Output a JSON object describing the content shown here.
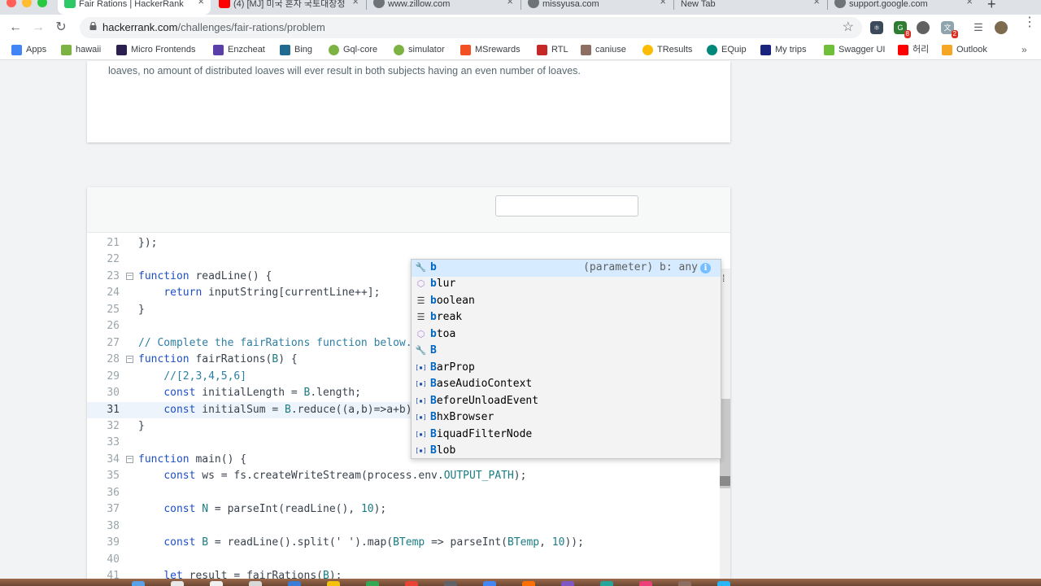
{
  "browser": {
    "tabs": [
      {
        "title": "Fair Rations | HackerRank",
        "icon": "hackerrank-icon",
        "active": true
      },
      {
        "title": "(4) [MJ] 미국 혼자 국토대장정",
        "icon": "youtube-icon",
        "active": false
      },
      {
        "title": "www.zillow.com",
        "icon": "globe-icon",
        "active": false
      },
      {
        "title": "missyusa.com",
        "icon": "globe-icon",
        "active": false
      },
      {
        "title": "New Tab",
        "icon": "none",
        "active": false
      },
      {
        "title": "support.google.com",
        "icon": "globe-icon",
        "active": false
      }
    ],
    "new_tab": "+",
    "close_glyph": "×",
    "url_host": "hackerrank.com",
    "url_path": "/challenges/fair-rations/problem",
    "extension_badges": [
      "8",
      "2"
    ],
    "bookmarks": [
      {
        "label": "Apps",
        "icon": "apps-grid-icon",
        "color": "#4285f4"
      },
      {
        "label": "hawaii",
        "icon": "hawaii-icon",
        "color": "#7cb342"
      },
      {
        "label": "Micro Frontends",
        "icon": "f-logo-icon",
        "color": "#2b1f4f"
      },
      {
        "label": "Enzcheat",
        "icon": "enzyme-icon",
        "color": "#5b3fa8"
      },
      {
        "label": "Bing",
        "icon": "bing-icon",
        "color": "#1e6b8f"
      },
      {
        "label": "Gql-core",
        "icon": "green-circle-icon",
        "color": "#7cb342"
      },
      {
        "label": "simulator",
        "icon": "green-circle-icon",
        "color": "#7cb342"
      },
      {
        "label": "MSrewards",
        "icon": "microsoft-icon",
        "color": "#f25022"
      },
      {
        "label": "RTL",
        "icon": "octopus-icon",
        "color": "#c62828"
      },
      {
        "label": "caniuse",
        "icon": "caniuse-icon",
        "color": "#8d6e63"
      },
      {
        "label": "TResults",
        "icon": "loader-icon",
        "color": "#fbbc05"
      },
      {
        "label": "EQuip",
        "icon": "equip-icon",
        "color": "#00897b"
      },
      {
        "label": "My trips",
        "icon": "v-logo-icon",
        "color": "#1a237e"
      },
      {
        "label": "Swagger UI",
        "icon": "swagger-icon",
        "color": "#6fbf3a"
      },
      {
        "label": "허리",
        "icon": "youtube-icon",
        "color": "#ff0000"
      },
      {
        "label": "Outlook",
        "icon": "outlook-icon",
        "color": "#f5a623"
      }
    ],
    "bookmarks_more": "»"
  },
  "problem": {
    "text": "loaves, no amount of distributed loaves will ever result in both subjects having an even number of loaves."
  },
  "editor": {
    "lines": [
      {
        "n": "21",
        "fold": false,
        "html": "});"
      },
      {
        "n": "22",
        "fold": false,
        "html": ""
      },
      {
        "n": "23",
        "fold": true,
        "html": "<span class=\"kw\">function</span> readLine() {"
      },
      {
        "n": "24",
        "fold": false,
        "html": "    <span class=\"kw\">return</span> inputString[currentLine++];"
      },
      {
        "n": "25",
        "fold": false,
        "html": "}"
      },
      {
        "n": "26",
        "fold": false,
        "html": ""
      },
      {
        "n": "27",
        "fold": false,
        "html": "<span class=\"cm\">// Complete the fairRations function below.</span>"
      },
      {
        "n": "28",
        "fold": true,
        "html": "<span class=\"kw\">function</span> fairRations(<span class=\"cn\">B</span>) {"
      },
      {
        "n": "29",
        "fold": false,
        "html": "    <span class=\"cm\">//[2,3,4,5,6]</span>"
      },
      {
        "n": "30",
        "fold": false,
        "html": "    <span class=\"kw\">const</span> initialLength = <span class=\"cn\">B</span>.length;"
      },
      {
        "n": "31",
        "fold": false,
        "current": true,
        "html": "    <span class=\"kw\">const</span> initialSum = <span class=\"cn\">B</span>.reduce((a,b)=>a+b)"
      },
      {
        "n": "32",
        "fold": false,
        "html": "}"
      },
      {
        "n": "33",
        "fold": false,
        "html": ""
      },
      {
        "n": "34",
        "fold": true,
        "html": "<span class=\"kw\">function</span> main() {"
      },
      {
        "n": "35",
        "fold": false,
        "html": "    <span class=\"kw\">const</span> ws = fs.createWriteStream(process.env.<span class=\"cn\">OUTPUT_PATH</span>);"
      },
      {
        "n": "36",
        "fold": false,
        "html": ""
      },
      {
        "n": "37",
        "fold": false,
        "html": "    <span class=\"kw\">const</span> <span class=\"cn\">N</span> = parseInt(readLine(), <span class=\"nm\">10</span>);"
      },
      {
        "n": "38",
        "fold": false,
        "html": ""
      },
      {
        "n": "39",
        "fold": false,
        "html": "    <span class=\"kw\">const</span> <span class=\"cn\">B</span> = readLine().split(<span class=\"st\">' '</span>).map(<span class=\"cn\">BTemp</span> => parseInt(<span class=\"cn\">BTemp</span>, <span class=\"nm\">10</span>));"
      },
      {
        "n": "40",
        "fold": false,
        "html": ""
      },
      {
        "n": "41",
        "fold": false,
        "html": "    <span class=\"kw\">let</span> result = fairRations(<span class=\"cn\">B</span>);"
      }
    ],
    "autocomplete": {
      "detail": "(parameter) b: any",
      "info": "i",
      "items": [
        {
          "match": "b",
          "rest": "",
          "icon": "wrench-icon",
          "glyph": "🔧",
          "color": "#424242",
          "selected": true
        },
        {
          "match": "b",
          "rest": "lur",
          "icon": "cube-icon",
          "glyph": "⬡",
          "color": "#b180d7",
          "selected": false
        },
        {
          "match": "b",
          "rest": "oolean",
          "icon": "keyword-icon",
          "glyph": "☰",
          "color": "#424242",
          "selected": false
        },
        {
          "match": "b",
          "rest": "reak",
          "icon": "keyword-icon",
          "glyph": "☰",
          "color": "#424242",
          "selected": false
        },
        {
          "match": "b",
          "rest": "toa",
          "icon": "cube-icon",
          "glyph": "⬡",
          "color": "#b180d7",
          "selected": false
        },
        {
          "match": "B",
          "rest": "",
          "icon": "wrench-icon",
          "glyph": "🔧",
          "color": "#424242",
          "selected": false
        },
        {
          "match": "B",
          "rest": "arProp",
          "icon": "variable-icon",
          "glyph": "[▪]",
          "color": "#1f4fa8",
          "selected": false
        },
        {
          "match": "B",
          "rest": "aseAudioContext",
          "icon": "variable-icon",
          "glyph": "[▪]",
          "color": "#1f4fa8",
          "selected": false
        },
        {
          "match": "B",
          "rest": "eforeUnloadEvent",
          "icon": "variable-icon",
          "glyph": "[▪]",
          "color": "#1f4fa8",
          "selected": false
        },
        {
          "match": "B",
          "rest": "hxBrowser",
          "icon": "variable-icon",
          "glyph": "[▪]",
          "color": "#1f4fa8",
          "selected": false
        },
        {
          "match": "B",
          "rest": "iquadFilterNode",
          "icon": "variable-icon",
          "glyph": "[▪]",
          "color": "#1f4fa8",
          "selected": false
        },
        {
          "match": "B",
          "rest": "lob",
          "icon": "variable-icon",
          "glyph": "[▪]",
          "color": "#1f4fa8",
          "selected": false
        }
      ]
    }
  },
  "colors": {
    "tab_strip": "#dee1e6",
    "accent_blue": "#0066bf",
    "current_line": "#eef4fb",
    "autocomplete_selected": "#d6ebff"
  }
}
